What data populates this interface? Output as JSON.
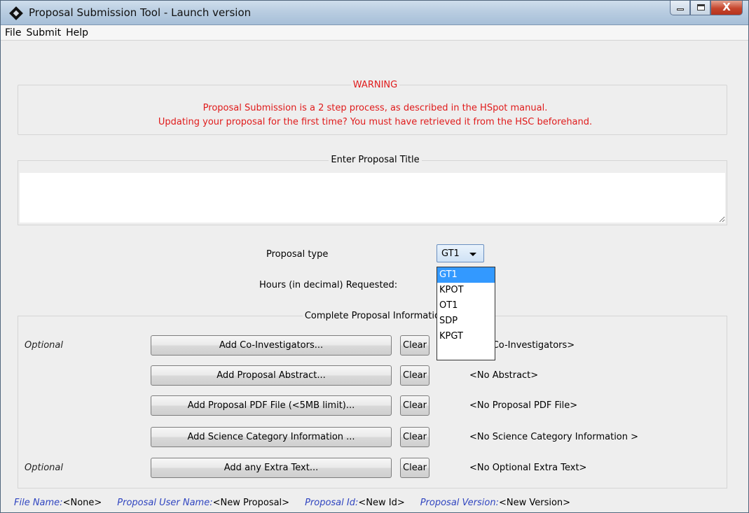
{
  "window": {
    "title": "Proposal Submission Tool - Launch version",
    "close_glyph": "X"
  },
  "menu": [
    "File",
    "Submit",
    "Help"
  ],
  "warning": {
    "title": "WARNING",
    "line1": "Proposal Submission is a 2 step process, as described in the HSpot manual.",
    "line2": "Updating your proposal for the first time? You must have retrieved it from the HSC beforehand.",
    "color": "#e01b1b"
  },
  "proposal_title": {
    "label": "Enter Proposal Title",
    "value": ""
  },
  "proposal_type": {
    "label": "Proposal type",
    "selected": "GT1",
    "options": [
      "GT1",
      "KPOT",
      "OT1",
      "SDP",
      "KPGT"
    ]
  },
  "hours": {
    "label": "Hours (in decimal) Requested:"
  },
  "info_section": {
    "label": "Complete Proposal Information",
    "rows": [
      {
        "optional": "Optional",
        "button": "Add Co-Investigators...",
        "clear": "Clear",
        "status": "<No Co-Investigators>"
      },
      {
        "optional": "",
        "button": "Add Proposal Abstract...",
        "clear": "Clear",
        "status": "<No Abstract>"
      },
      {
        "optional": "",
        "button": "Add Proposal PDF File (<5MB limit)...",
        "clear": "Clear",
        "status": "<No Proposal PDF File>"
      },
      {
        "optional": "",
        "button": "Add Science Category Information ...",
        "clear": "Clear",
        "status": "<No Science Category Information >"
      },
      {
        "optional": "Optional",
        "button": "Add any Extra Text...",
        "clear": "Clear",
        "status": "<No Optional Extra Text>"
      }
    ]
  },
  "statusbar": {
    "file_name_label": "File Name:",
    "file_name_value": "<None>",
    "user_name_label": "Proposal User Name:",
    "user_name_value": "<New Proposal>",
    "id_label": "Proposal Id:",
    "id_value": "<New Id>",
    "version_label": "Proposal Version:",
    "version_value": "<New Version>",
    "label_color": "#3045c0"
  }
}
